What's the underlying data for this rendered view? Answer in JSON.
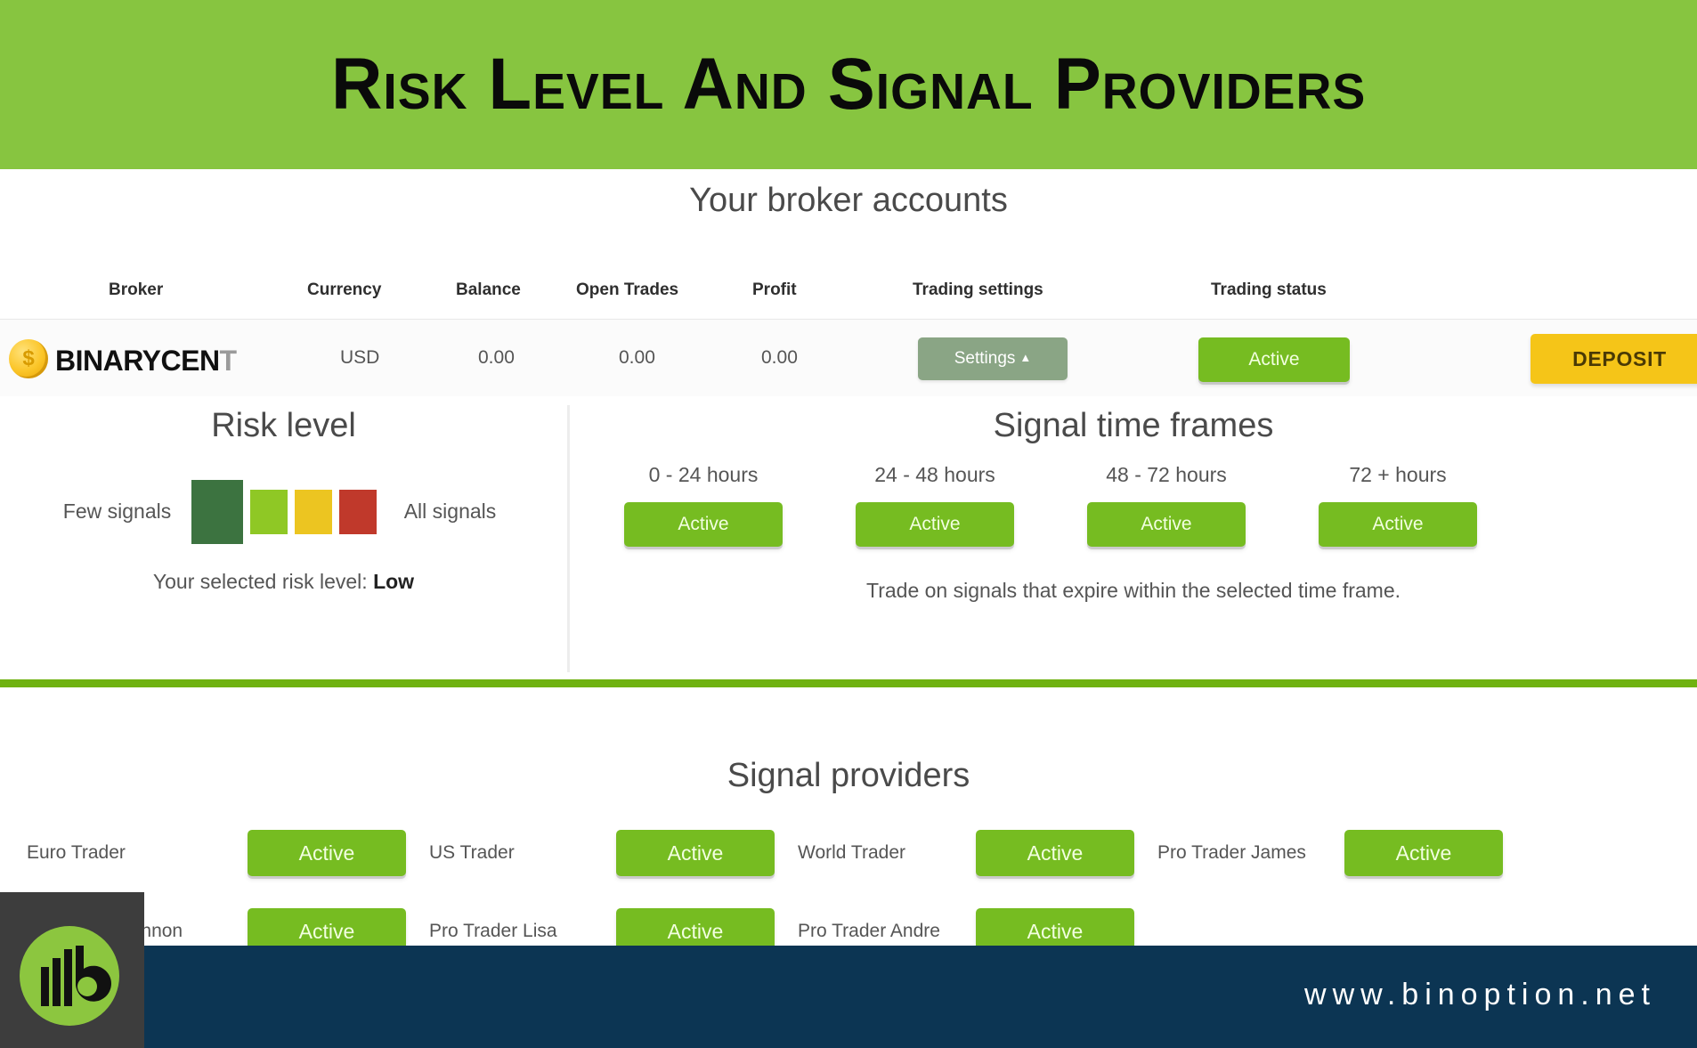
{
  "header": {
    "title": "Risk Level And Signal Providers",
    "background": "#87C540"
  },
  "broker_section": {
    "title": "Your broker accounts",
    "columns": [
      "Broker",
      "Currency",
      "Balance",
      "Open Trades",
      "Profit",
      "Trading settings",
      "Trading status"
    ],
    "row": {
      "broker_name_bold": "BINARYCEN",
      "broker_name_light": "T",
      "coin_symbol": "$",
      "currency": "USD",
      "balance": "0.00",
      "open_trades": "0.00",
      "profit": "0.00",
      "settings_label": "Settings",
      "settings_caret": "▲",
      "trading_status": "Active",
      "deposit_label": "DEPOSIT"
    }
  },
  "risk_level": {
    "title": "Risk level",
    "left_label": "Few signals",
    "right_label": "All signals",
    "swatches": [
      {
        "name": "low",
        "color": "#3C7340",
        "selected": true
      },
      {
        "name": "medium",
        "color": "#8FC825",
        "selected": false
      },
      {
        "name": "high",
        "color": "#ECC521",
        "selected": false
      },
      {
        "name": "very-high",
        "color": "#C0392B",
        "selected": false
      }
    ],
    "selected_prefix": "Your selected risk level: ",
    "selected_value": "Low"
  },
  "signal_time_frames": {
    "title": "Signal time frames",
    "frames": [
      {
        "label": "0 - 24 hours",
        "status": "Active"
      },
      {
        "label": "24 - 48 hours",
        "status": "Active"
      },
      {
        "label": "48 - 72 hours",
        "status": "Active"
      },
      {
        "label": "72 + hours",
        "status": "Active"
      }
    ],
    "note": "Trade on signals that expire within the selected time frame."
  },
  "signal_providers": {
    "title": "Signal providers",
    "rows": [
      [
        {
          "name": "Euro Trader",
          "status": "Active"
        },
        {
          "name": "US Trader",
          "status": "Active"
        },
        {
          "name": "World Trader",
          "status": "Active"
        },
        {
          "name": "Pro Trader James",
          "status": "Active"
        }
      ],
      [
        {
          "name": "Pro Trader Lennon",
          "status": "Active"
        },
        {
          "name": "Pro Trader Lisa",
          "status": "Active"
        },
        {
          "name": "Pro Trader Andre",
          "status": "Active"
        }
      ]
    ]
  },
  "footer": {
    "url": "www.binoption.net",
    "background": "#0C3553",
    "logo_color": "#8CC63F"
  },
  "colors": {
    "accent_green": "#87C540",
    "active_green": "#76BC21",
    "divider_green": "#6FB211",
    "deposit_yellow": "#F5C518",
    "settings_gray": "#8aa585"
  }
}
